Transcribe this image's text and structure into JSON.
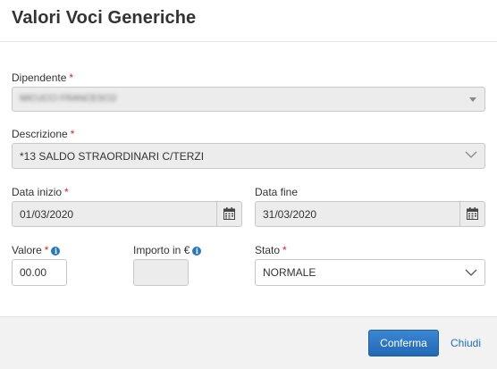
{
  "dialog": {
    "title": "Valori Voci Generiche"
  },
  "form": {
    "required_mark": "*",
    "info_glyph": "i",
    "dipendente": {
      "label": "Dipendente",
      "value": "MICUCCI FRANCESCO",
      "value_blurred": true
    },
    "descrizione": {
      "label": "Descrizione",
      "value": "*13 SALDO STRAORDINARI C/TERZI"
    },
    "data_inizio": {
      "label": "Data inizio",
      "value": "01/03/2020",
      "icon": "calendar-icon"
    },
    "data_fine": {
      "label": "Data fine",
      "value": "31/03/2020",
      "icon": "calendar-icon"
    },
    "valore": {
      "label": "Valore",
      "value": "00.00",
      "icon": "info-icon"
    },
    "importo": {
      "label": "Importo in €",
      "value": "",
      "icon": "info-icon"
    },
    "stato": {
      "label": "Stato",
      "value": "NORMALE"
    }
  },
  "footer": {
    "confirm_label": "Conferma",
    "close_label": "Chiudi"
  },
  "colors": {
    "accent": "#2a77c1",
    "required": "#d9232d",
    "primary_button": "#2268b5"
  }
}
